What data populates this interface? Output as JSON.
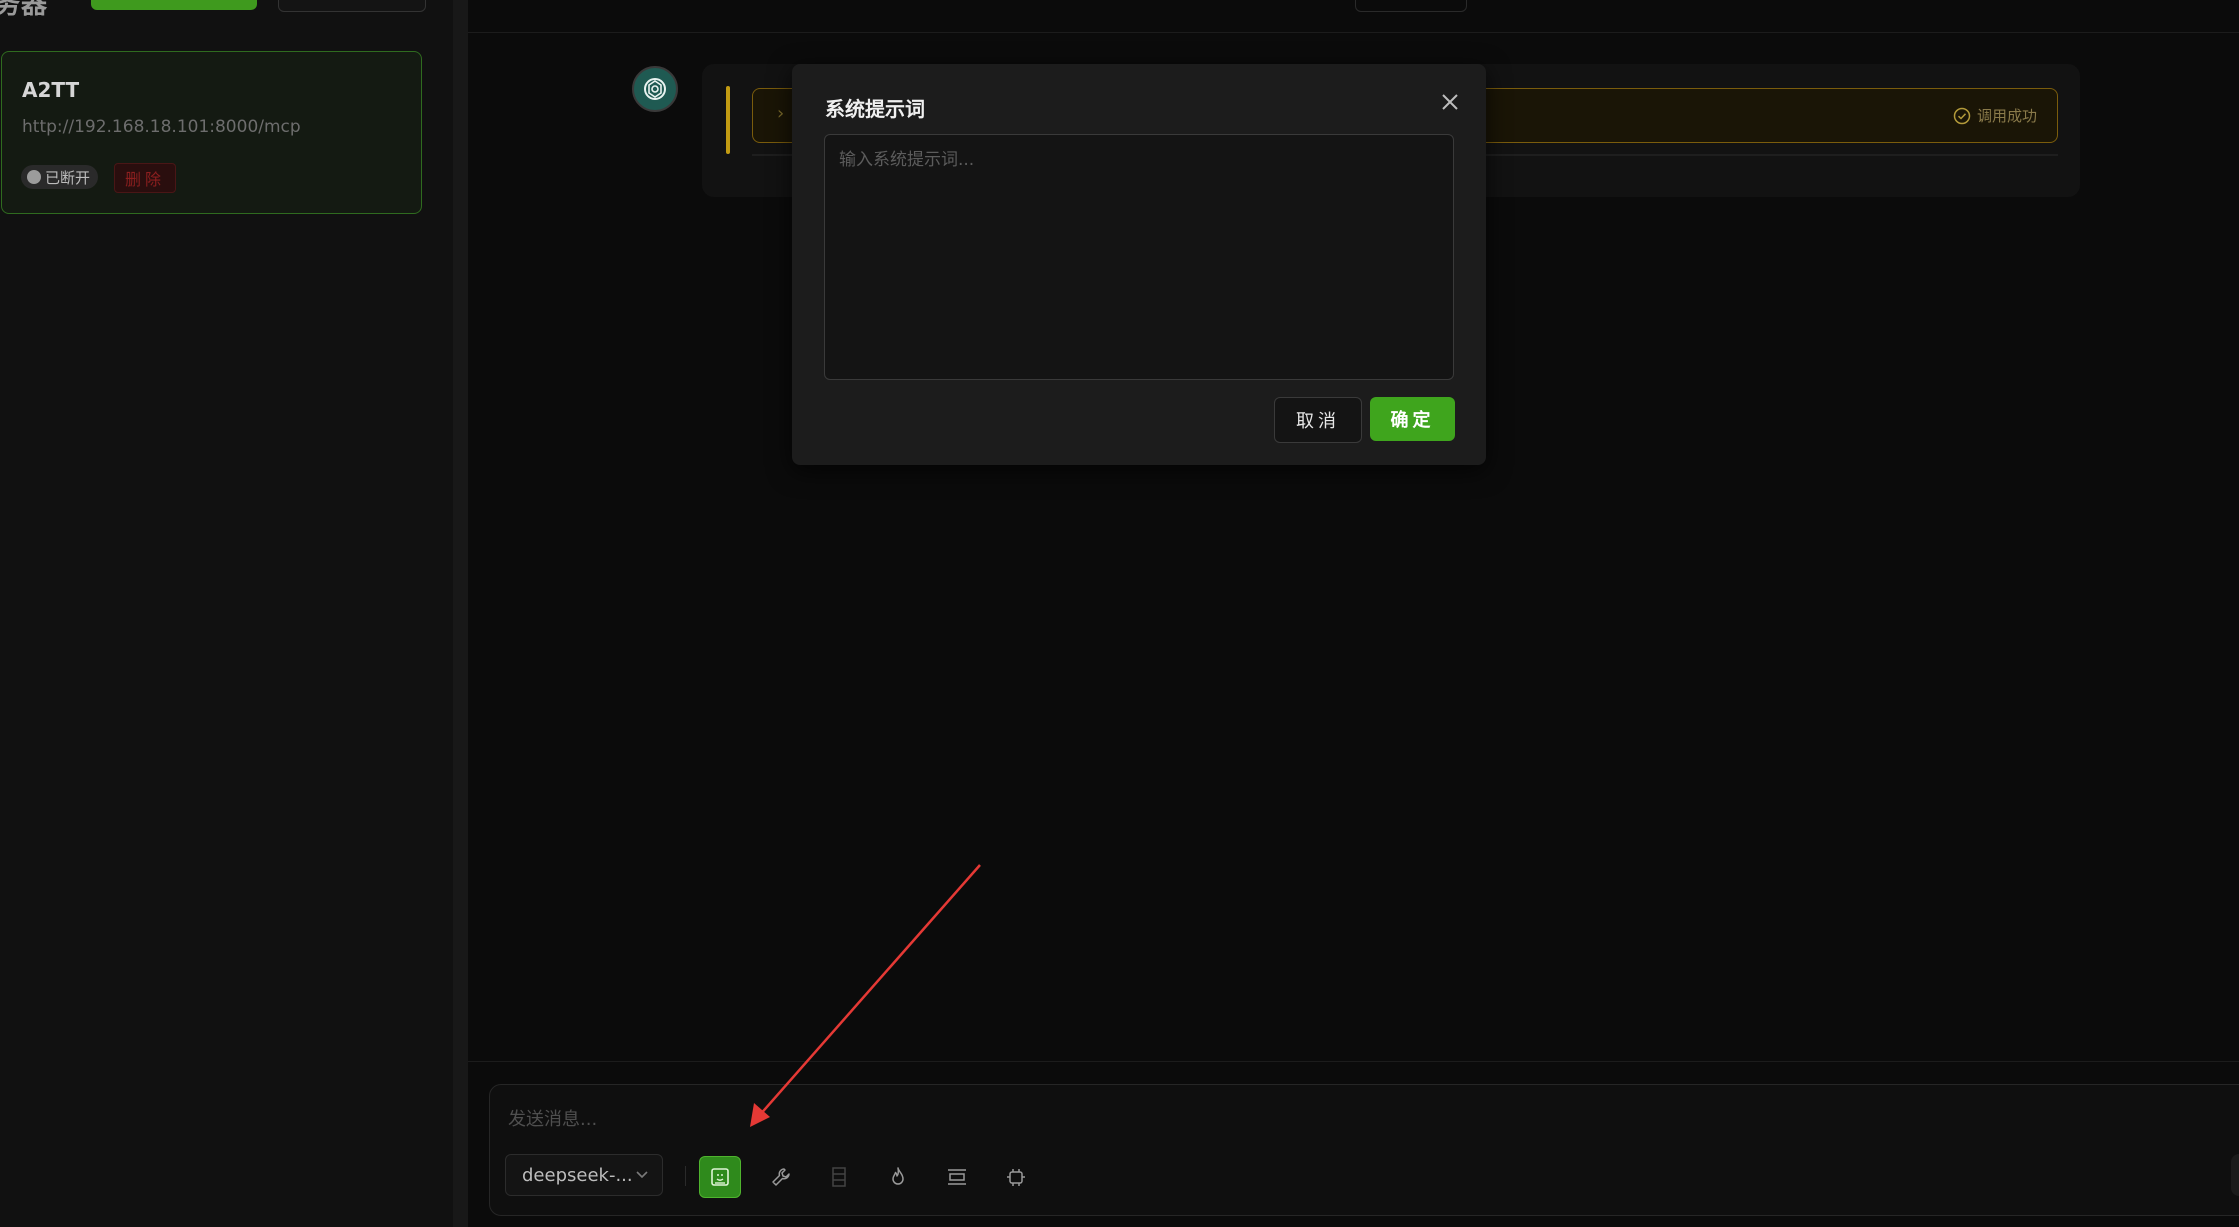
{
  "sidebar": {
    "heading": "务器",
    "server": {
      "name": "A2TT",
      "url": "http://192.168.18.101:8000/mcp",
      "status": "已断开",
      "delete_label": "删除"
    }
  },
  "chat": {
    "tool_call": {
      "status": "调用成功",
      "status_color": "#8a7a4a"
    }
  },
  "input": {
    "placeholder": "发送消息...",
    "model": "deepseek-..."
  },
  "toolbar": {
    "icons": [
      "system-prompt-icon",
      "wrench-icon",
      "document-icon",
      "flame-icon",
      "format-icon",
      "robot-icon"
    ],
    "active": "system-prompt-icon"
  },
  "modal": {
    "title": "系统提示词",
    "textarea_placeholder": "输入系统提示词...",
    "cancel_label": "取消",
    "ok_label": "确定"
  },
  "colors": {
    "accent_green": "#3fa51d",
    "annotation_arrow": "#e53935",
    "warning_border": "#7a5c0c"
  }
}
